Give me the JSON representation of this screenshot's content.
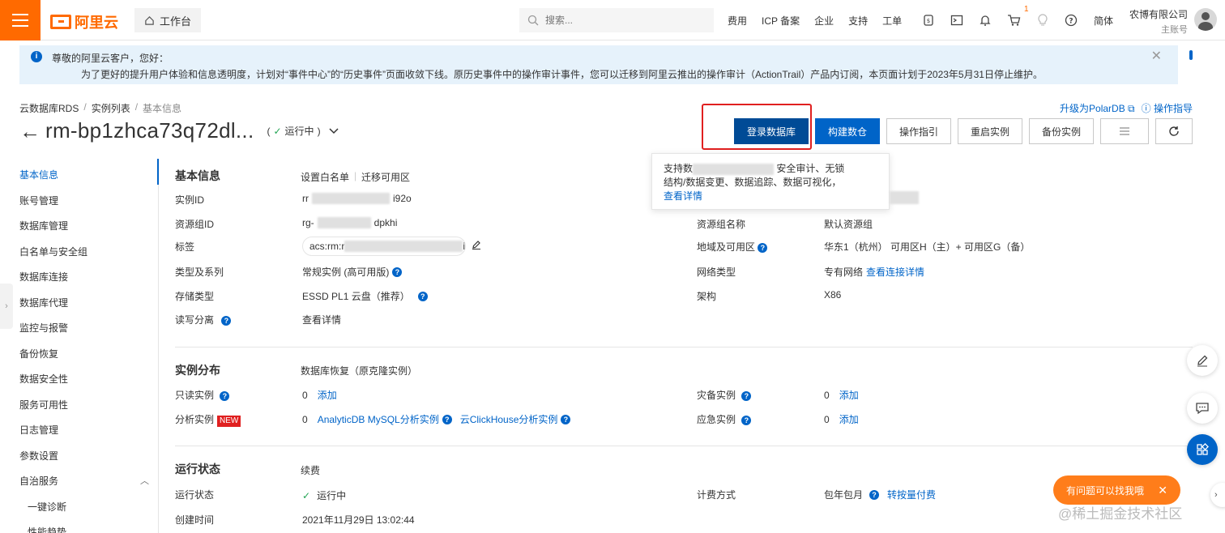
{
  "topbar": {
    "logo": "阿里云",
    "workbench": "工作台",
    "search_placeholder": "搜索...",
    "nav": [
      "费用",
      "ICP 备案",
      "企业",
      "支持",
      "工单"
    ],
    "cart_count": "1",
    "lang": "简体",
    "account_name": "农博有限公司",
    "account_sub": "主账号"
  },
  "notice": {
    "line1": "尊敬的阿里云客户，您好：",
    "line2": "为了更好的提升用户体验和信息透明度，计划对“事件中心”的“历史事件”页面收敛下线。原历史事件中的操作审计事件，您可以迁移到阿里云推出的操作审计（ActionTrail）产品内订阅，本页面计划于2023年5月31日停止维护。"
  },
  "breadcrumb": [
    "云数据库RDS",
    "实例列表",
    "基本信息"
  ],
  "header": {
    "title": "rm-bp1zhca73q72dl...",
    "status": "运行中",
    "link_polardb": "升级为PolarDB",
    "link_guide": "操作指导"
  },
  "actions": {
    "login_db": "登录数据库",
    "build_warehouse": "构建数仓",
    "op_guide": "操作指引",
    "restart": "重启实例",
    "backup": "备份实例"
  },
  "tooltip": {
    "text_a": "支持数",
    "text_b": "安全审计、无锁",
    "text_c": "结构/数据变更、数据追踪、数据可视化，",
    "link": "查看详情"
  },
  "sidebar": {
    "items": [
      "基本信息",
      "账号管理",
      "数据库管理",
      "白名单与安全组",
      "数据库连接",
      "数据库代理",
      "监控与报警",
      "备份恢复",
      "数据安全性",
      "服务可用性",
      "日志管理",
      "参数设置",
      "自治服务",
      "一键诊断",
      "性能趋势"
    ]
  },
  "basic": {
    "title": "基本信息",
    "link_whitelist": "设置白名单",
    "link_migrate": "迁移可用区",
    "instance_id_label": "实例ID",
    "instance_id_a": "rr",
    "instance_id_b": "i92o",
    "rg_id_label": "资源组ID",
    "rg_id_a": "rg-",
    "rg_id_b": "dpkhi",
    "rg_name_label": "资源组名称",
    "rg_name": "默认资源组",
    "tag_label": "标签",
    "tag_value_a": "acs:rm:r",
    "tag_value_b": "i",
    "region_label": "地域及可用区",
    "region": "华东1（杭州） 可用区H（主）+ 可用区G（备）",
    "type_label": "类型及系列",
    "type": "常规实例 (高可用版)",
    "network_label": "网络类型",
    "network": "专有网络",
    "network_link": "查看连接详情",
    "storage_label": "存储类型",
    "storage": "ESSD PL1 云盘（推荐）",
    "arch_label": "架构",
    "arch": "X86",
    "rw_label": "读写分离",
    "rw_link": "查看详情"
  },
  "distribution": {
    "title": "实例分布",
    "link_restore": "数据库恢复（原克隆实例）",
    "readonly_label": "只读实例",
    "readonly_count": "0",
    "add": "添加",
    "dr_label": "灾备实例",
    "dr_count": "0",
    "analysis_label": "分析实例",
    "new_badge": "NEW",
    "analysis_count": "0",
    "analytic_link": "AnalyticDB MySQL分析实例",
    "clickhouse_link": "云ClickHouse分析实例",
    "emergency_label": "应急实例",
    "emergency_count": "0"
  },
  "running": {
    "title": "运行状态",
    "link_renew": "续费",
    "status_label": "运行状态",
    "status": "运行中",
    "billing_label": "计费方式",
    "billing": "包年包月",
    "billing_link": "转按量付费",
    "created_label": "创建时间",
    "created": "2021年11月29日 13:02:44"
  },
  "float": {
    "help": "有问题可以找我哦"
  },
  "watermark": "@稀土掘金技术社区",
  "colors": {
    "brand": "#ff6a00",
    "primary": "#0064c8",
    "success": "#21a453",
    "danger": "#e02020"
  }
}
